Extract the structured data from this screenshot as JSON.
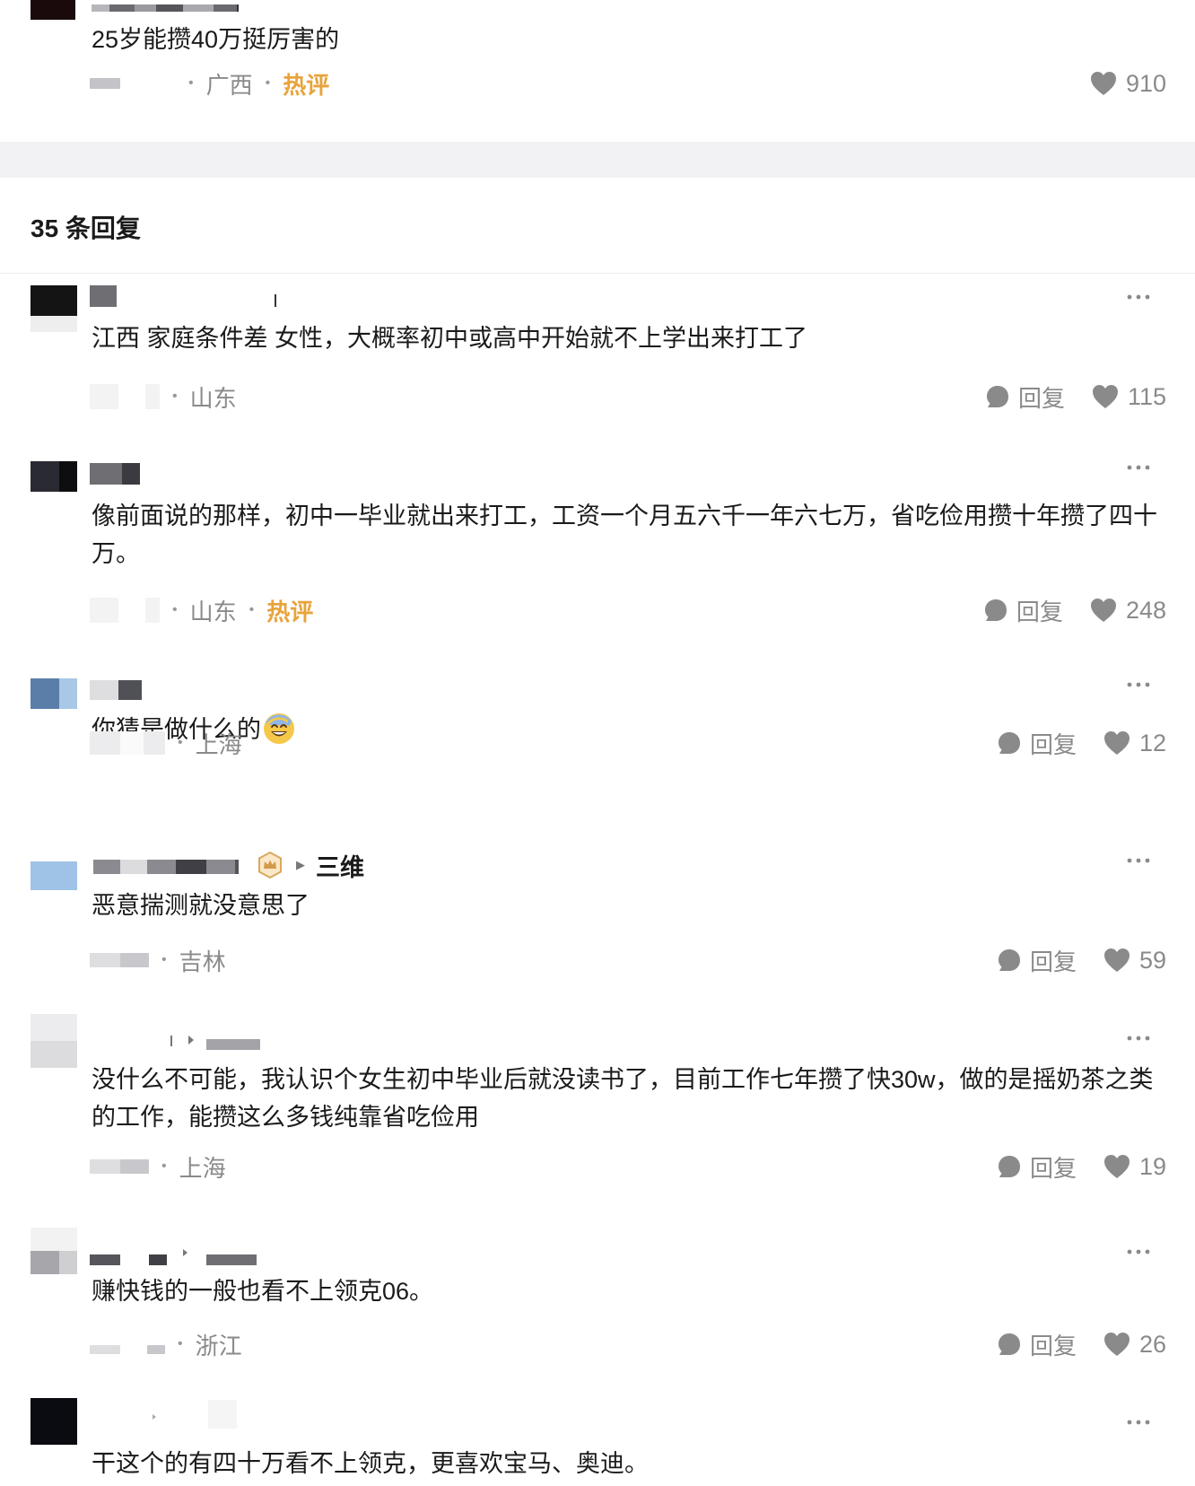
{
  "top_comment": {
    "text": "25岁能攒40万挺厉害的",
    "region": "广西",
    "hot_label": "热评",
    "likes": "910"
  },
  "replies_header": "35 条回复",
  "actions": {
    "reply_label": "回复"
  },
  "replies": [
    {
      "text": "江西 家庭条件差 女性，大概率初中或高中开始就不上学出来打工了",
      "region": "山东",
      "hot": "",
      "likes": "115"
    },
    {
      "text": "像前面说的那样，初中一毕业就出来打工，工资一个月五六千一年六七万，省吃俭用攒十年攒了四十万。",
      "region": "山东",
      "hot": "热评",
      "likes": "248"
    },
    {
      "text": "你猜是做什么的",
      "emoji": "cold-sweat-smile-emoji",
      "region": "上海",
      "hot": "",
      "likes": "12"
    },
    {
      "target_name": "三维",
      "text": "恶意揣测就没意思了",
      "region": "吉林",
      "hot": "",
      "likes": "59"
    },
    {
      "text": "没什么不可能，我认识个女生初中毕业后就没读书了，目前工作七年攒了快30w，做的是摇奶茶之类的工作，能攒这么多钱纯靠省吃俭用",
      "region": "上海",
      "hot": "",
      "likes": "19"
    },
    {
      "text": "赚快钱的一般也看不上领克06。",
      "region": "浙江",
      "hot": "",
      "likes": "26"
    },
    {
      "text": "干这个的有四十万看不上领克，更喜欢宝马、奥迪。"
    }
  ],
  "icons": {
    "reply": "speech-bubble-icon",
    "like": "heart-icon",
    "more": "more-dots-icon",
    "badge": "crown-badge-icon",
    "arrow": "reply-arrow-icon"
  },
  "colors": {
    "hot": "#e8a33a",
    "meta": "#8a8a8a",
    "icon": "#8a8a8a",
    "band": "#f2f2f4"
  }
}
